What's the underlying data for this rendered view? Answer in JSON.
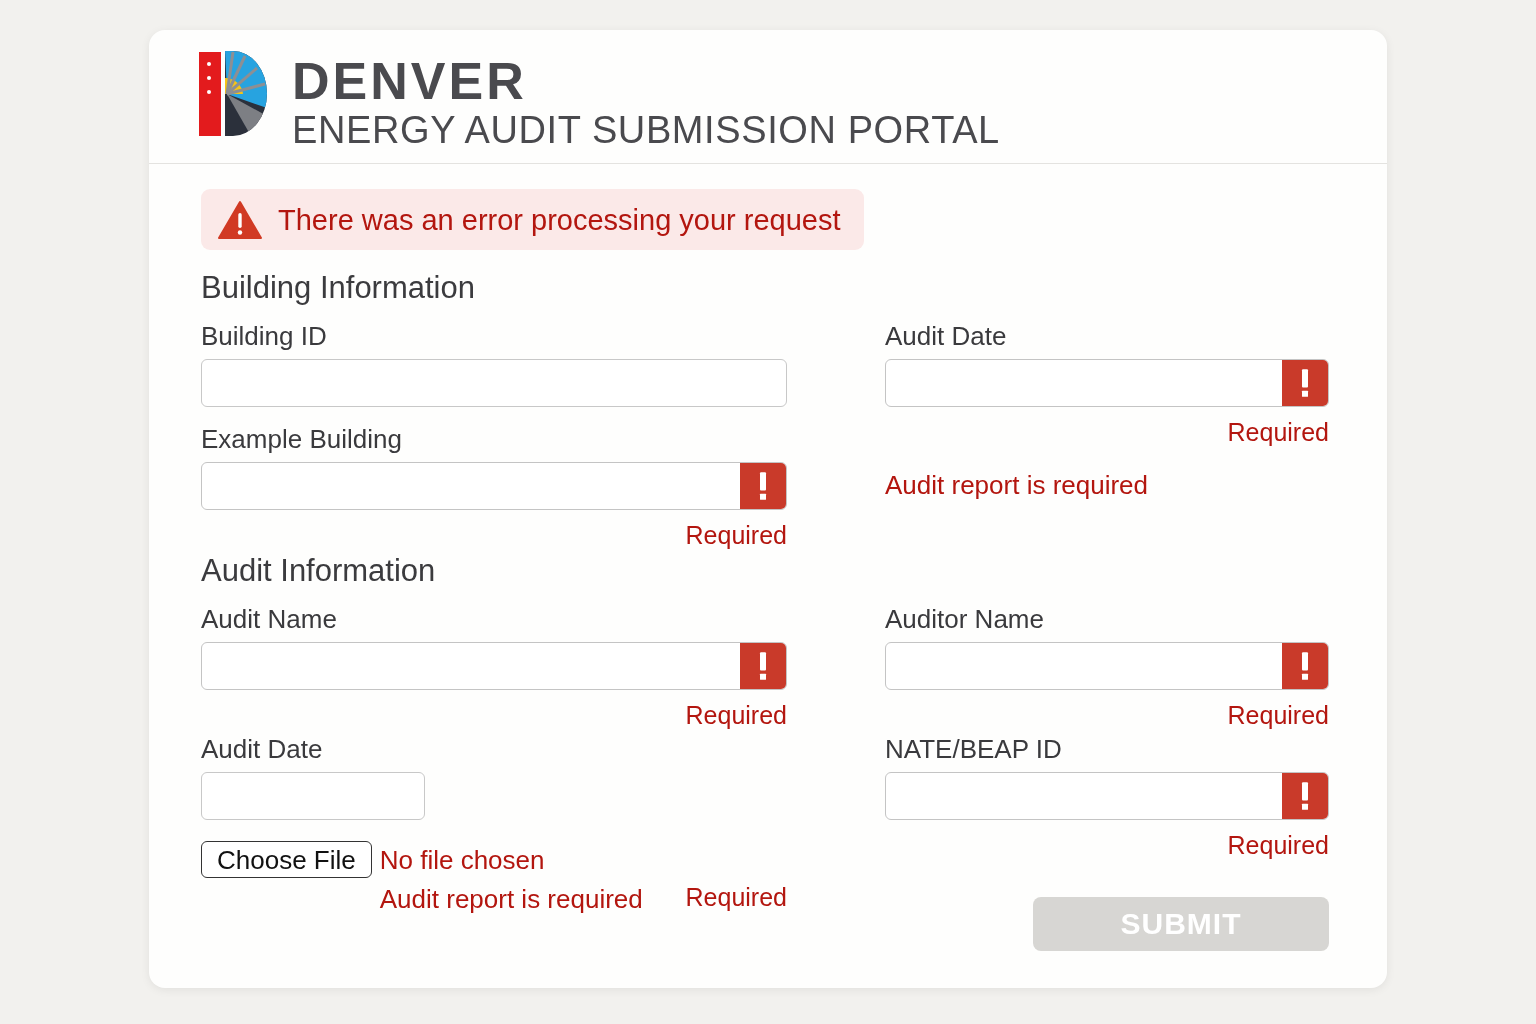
{
  "header": {
    "title": "DENVER",
    "subtitle": "ENERGY AUDIT SUBMISSION PORTAL"
  },
  "error_banner": {
    "message": "There was an error processing your request"
  },
  "sections": [
    {
      "title": "Building Information",
      "columns": [
        [
          {
            "kind": "text",
            "label": "Building ID",
            "invalid": false
          },
          {
            "kind": "text",
            "label": "Example Building",
            "invalid": true,
            "error": "Required"
          }
        ],
        [
          {
            "kind": "text",
            "label": "Audit Date",
            "invalid": true,
            "error": "Required"
          },
          {
            "kind": "message",
            "text": "Audit report is required"
          }
        ]
      ]
    },
    {
      "title": "Audit Information",
      "columns": [
        [
          {
            "kind": "text",
            "label": "Audit Name",
            "invalid": true,
            "error": "Required"
          },
          {
            "kind": "date",
            "label": "Audit Date",
            "invalid": false
          },
          {
            "kind": "file",
            "button": "Choose File",
            "status": "No file chosen",
            "message": "Audit report is required",
            "error": "Required"
          }
        ],
        [
          {
            "kind": "text",
            "label": "Auditor Name",
            "invalid": true,
            "error": "Required"
          },
          {
            "kind": "text",
            "label": "NATE/BEAP ID",
            "invalid": true,
            "error": "Required"
          },
          {
            "kind": "submit",
            "label": "SUBMIT",
            "disabled": true
          }
        ]
      ]
    }
  ]
}
